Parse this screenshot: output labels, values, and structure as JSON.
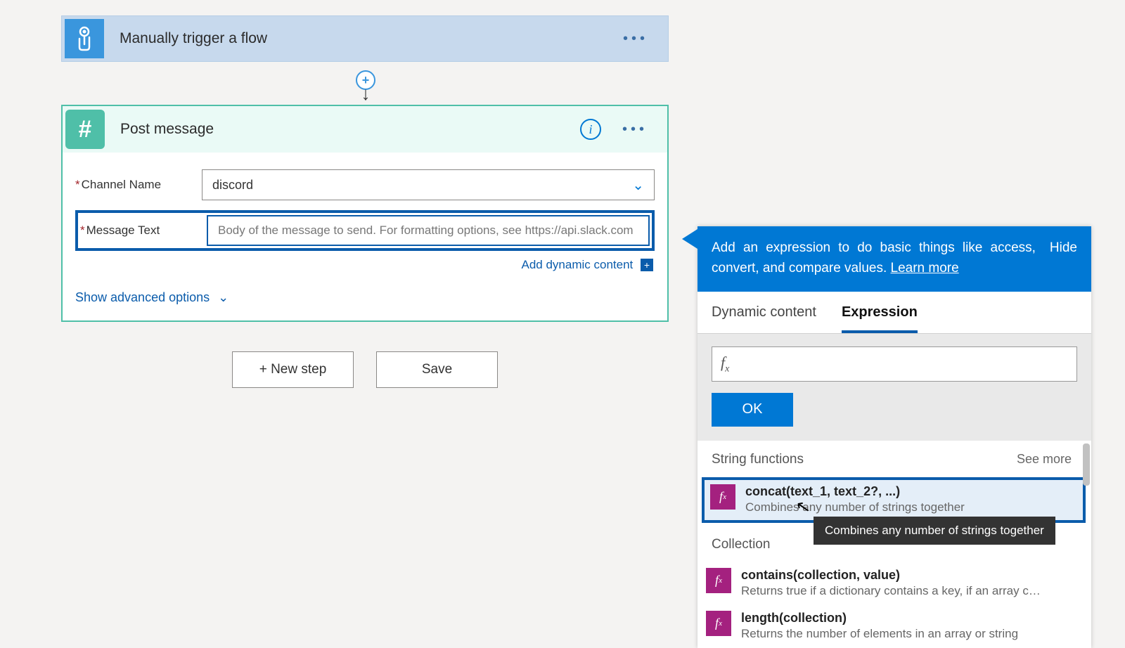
{
  "trigger": {
    "title": "Manually trigger a flow"
  },
  "post": {
    "title": "Post message",
    "channel_label": "Channel Name",
    "channel_value": "discord",
    "message_label": "Message Text",
    "message_placeholder": "Body of the message to send. For formatting options, see https://api.slack.com",
    "add_dynamic": "Add dynamic content",
    "show_advanced": "Show advanced options"
  },
  "buttons": {
    "new_step": "+ New step",
    "save": "Save"
  },
  "expr": {
    "headline": "Add an expression to do basic things like access, convert, and compare values.",
    "learn_more": "Learn more",
    "hide": "Hide",
    "tabs": {
      "dynamic": "Dynamic content",
      "expression": "Expression"
    },
    "fx": "",
    "ok": "OK",
    "cat_string": "String functions",
    "cat_collection": "Collection",
    "see_more": "See more",
    "functions": {
      "concat": {
        "name": "concat(text_1, text_2?, ...)",
        "desc": "Combines any number of strings together"
      },
      "contains": {
        "name": "contains(collection, value)",
        "desc": "Returns true if a dictionary contains a key, if an array cont..."
      },
      "length": {
        "name": "length(collection)",
        "desc": "Returns the number of elements in an array or string"
      }
    },
    "tooltip": "Combines any number of strings together"
  }
}
